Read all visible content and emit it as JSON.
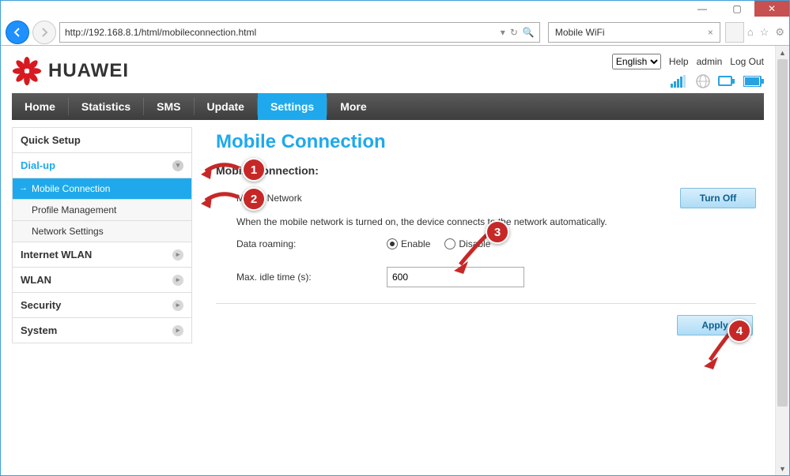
{
  "browser": {
    "url": "http://192.168.8.1/html/mobileconnection.html",
    "tab_title": "Mobile WiFi"
  },
  "header": {
    "brand": "HUAWEI",
    "language_selected": "English",
    "help": "Help",
    "admin": "admin",
    "logout": "Log Out"
  },
  "nav": {
    "items": [
      "Home",
      "Statistics",
      "SMS",
      "Update",
      "Settings",
      "More"
    ],
    "active_index": 4
  },
  "sidebar": {
    "quick_setup": "Quick Setup",
    "dialup": {
      "label": "Dial-up",
      "expanded": true,
      "children": [
        "Mobile Connection",
        "Profile Management",
        "Network Settings"
      ],
      "active_child": 0
    },
    "internet_wlan": "Internet WLAN",
    "wlan": "WLAN",
    "security": "Security",
    "system": "System"
  },
  "content": {
    "page_title": "Mobile Connection",
    "section_title": "Mobile Connection:",
    "mobile_network_label": "Mobile Network",
    "turn_off": "Turn Off",
    "mobile_network_desc": "When the mobile network is turned on, the device connects to the network automatically.",
    "roaming_label": "Data roaming:",
    "roaming_enable": "Enable",
    "roaming_disable": "Disable",
    "roaming_value": "enable",
    "idle_label": "Max. idle time (s):",
    "idle_value": "600",
    "apply": "Apply"
  },
  "annotations": {
    "a1": "1",
    "a2": "2",
    "a3": "3",
    "a4": "4"
  }
}
